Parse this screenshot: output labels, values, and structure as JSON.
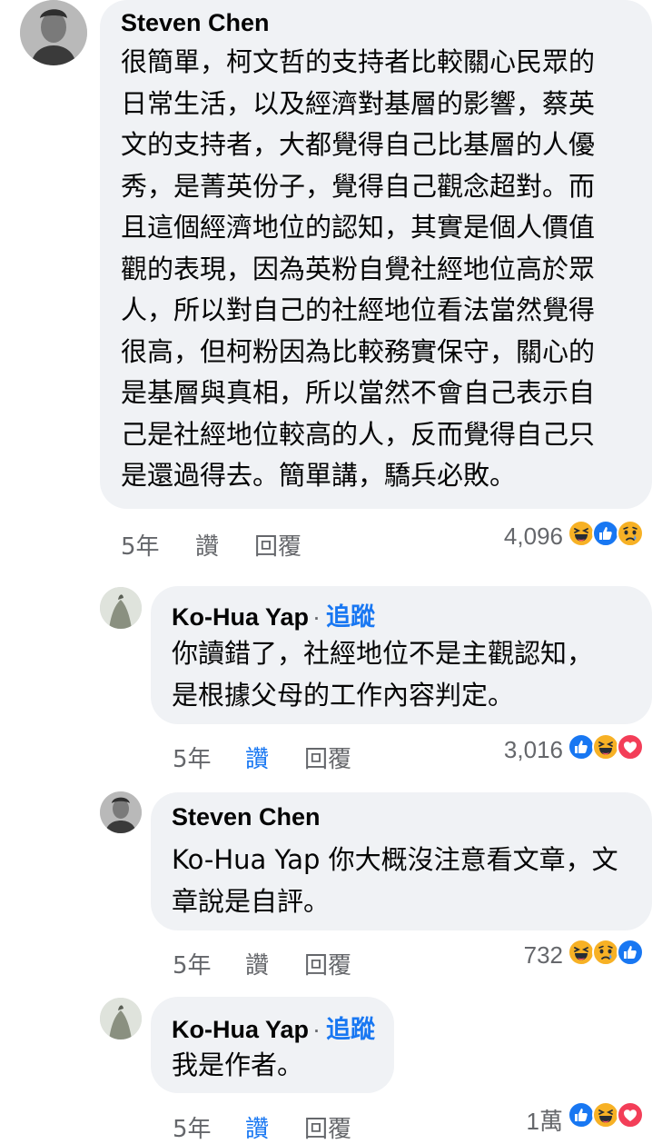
{
  "comments": [
    {
      "author": "Steven Chen",
      "follow": "",
      "lines": [
        "很簡單，柯文哲的支持者比較關心民眾的",
        "日常生活，以及經濟對基層的影響，蔡英",
        "文的支持者，大都覺得自己比基層的人優",
        "秀，是菁英份子，覺得自己觀念超對。而",
        "且這個經濟地位的認知，其實是個人價值",
        "觀的表現，因為英粉自覺社經地位高於眾",
        "人，所以對自己的社經地位看法當然覺得",
        "很高，但柯粉因為比較務實保守，關心的",
        "是基層與真相，所以當然不會自己表示自",
        "己是社經地位較高的人，反而覺得自己只",
        "是還過得去。簡單講，驕兵必敗。"
      ],
      "time": "5年",
      "like": "讚",
      "reply": "回覆",
      "reaction_count": "4,096",
      "reactions": [
        "haha-icon",
        "like-icon",
        "sad-icon"
      ]
    },
    {
      "author": "Ko-Hua Yap",
      "dot": "·",
      "follow": "追蹤",
      "lines": [
        "你讀錯了，社經地位不是主觀認知，",
        "是根據父母的工作內容判定。"
      ],
      "time": "5年",
      "like": "讚",
      "reply": "回覆",
      "reaction_count": "3,016",
      "reactions": [
        "like-icon",
        "haha-icon",
        "love-icon"
      ]
    },
    {
      "author": "Steven Chen",
      "follow": "",
      "lines": [
        "Ko-Hua Yap 你大概沒注意看文章，文",
        "章說是自評。"
      ],
      "time": "5年",
      "like": "讚",
      "reply": "回覆",
      "reaction_count": "732",
      "reactions": [
        "haha-icon",
        "sad-icon",
        "like-icon"
      ]
    },
    {
      "author": "Ko-Hua Yap",
      "dot": "·",
      "follow": "追蹤",
      "lines": [
        "我是作者。"
      ],
      "time": "5年",
      "like": "讚",
      "reply": "回覆",
      "reaction_count": "1萬",
      "reactions": [
        "like-icon",
        "haha-icon",
        "love-icon"
      ]
    }
  ],
  "colors": {
    "bubble": "#f0f2f5",
    "like_blue": "#1877f2",
    "meta_gray": "#65676b",
    "love_red": "#f33e58",
    "emoji_yellow": "#f7b125"
  }
}
